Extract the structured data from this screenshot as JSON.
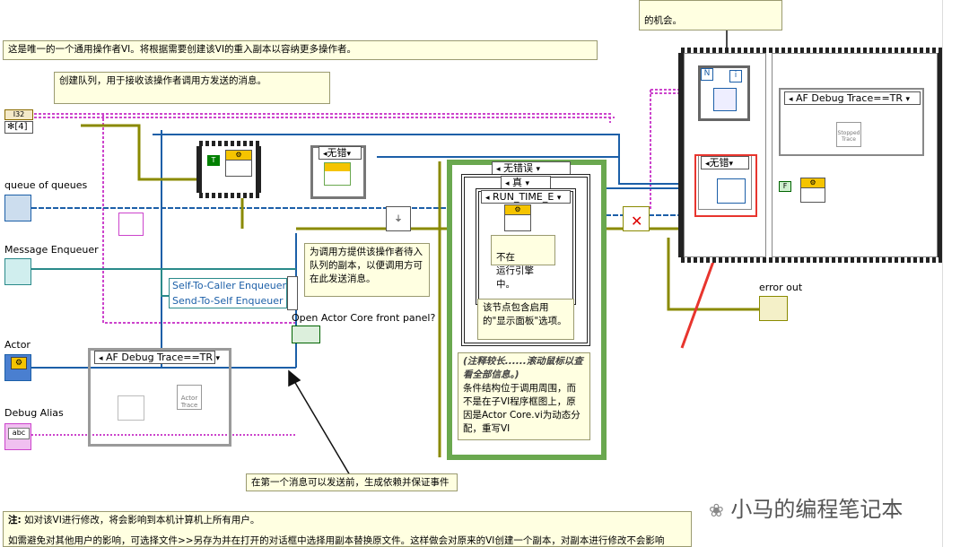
{
  "notes": {
    "top_right": "的机会。",
    "top_left": "这是唯一的一个通用操作者VI。将根据需要创建该VI的重入副本以容纳更多操作者。",
    "create_queue": "创建队列，用于接收该操作者调用方发送的消息。",
    "copy_queue": "为调用方提供该操作者待入队列的副本，以便调用方可在此发送消息。",
    "not_running": "不在\n运行引擎中。",
    "front_panel_opt": "该节点包含启用的\"显示面板\"选项。",
    "long_note_title": "(注释较长......滚动鼠标以查看全部信息。)",
    "long_note_body": "条件结构位于调用周围，而不是在子VI程序框图上，原因是Actor Core.vi为动态分配，重写VI",
    "first_msg": "在第一个消息可以发送前，生成依赖并保证事件",
    "bottom_note_bold": "注:",
    "bottom_note_1": "如对该VI进行修改，将会影响到本机计算机上所有用户。",
    "bottom_note_2": "如需避免对其他用户的影响，可选择文件>>另存为并在打开的对话框中选择用副本替换原文件。这样做会对原来的VI创建一个副本，对副本进行修改不会影响"
  },
  "labels": {
    "queue_of_queues": "queue of queues",
    "message_enqueuer": "Message Enqueuer",
    "actor": "Actor",
    "debug_alias": "Debug Alias",
    "error_out": "error out",
    "open_front_panel": "Open Actor Core front panel?",
    "self_to_caller": "Self-To-Caller Enqueuer",
    "send_to_self": "Send-To-Self Enqueuer",
    "const_4": "[4]",
    "abc": "abc"
  },
  "selectors": {
    "af_debug_left": "AF Debug Trace==TR",
    "af_debug_right": "AF Debug Trace==TR",
    "no_error_1": "无错",
    "no_error_2": "无错误",
    "true_case": "真",
    "run_time": "RUN_TIME_E",
    "no_error_3": "无错"
  },
  "misc": {
    "stopped_trace": "Stopped Trace",
    "actor_trace": "Actor Trace",
    "shutdown": "Shutdown"
  },
  "watermark": "小马的编程笔记本",
  "colors": {
    "wire_pink": "#cc44cc",
    "wire_blue": "#1c5fa8",
    "wire_olive": "#8a8a00",
    "wire_teal": "#2a8a8a",
    "annotation_red": "#e8352e",
    "note_bg": "#ffffe1"
  }
}
